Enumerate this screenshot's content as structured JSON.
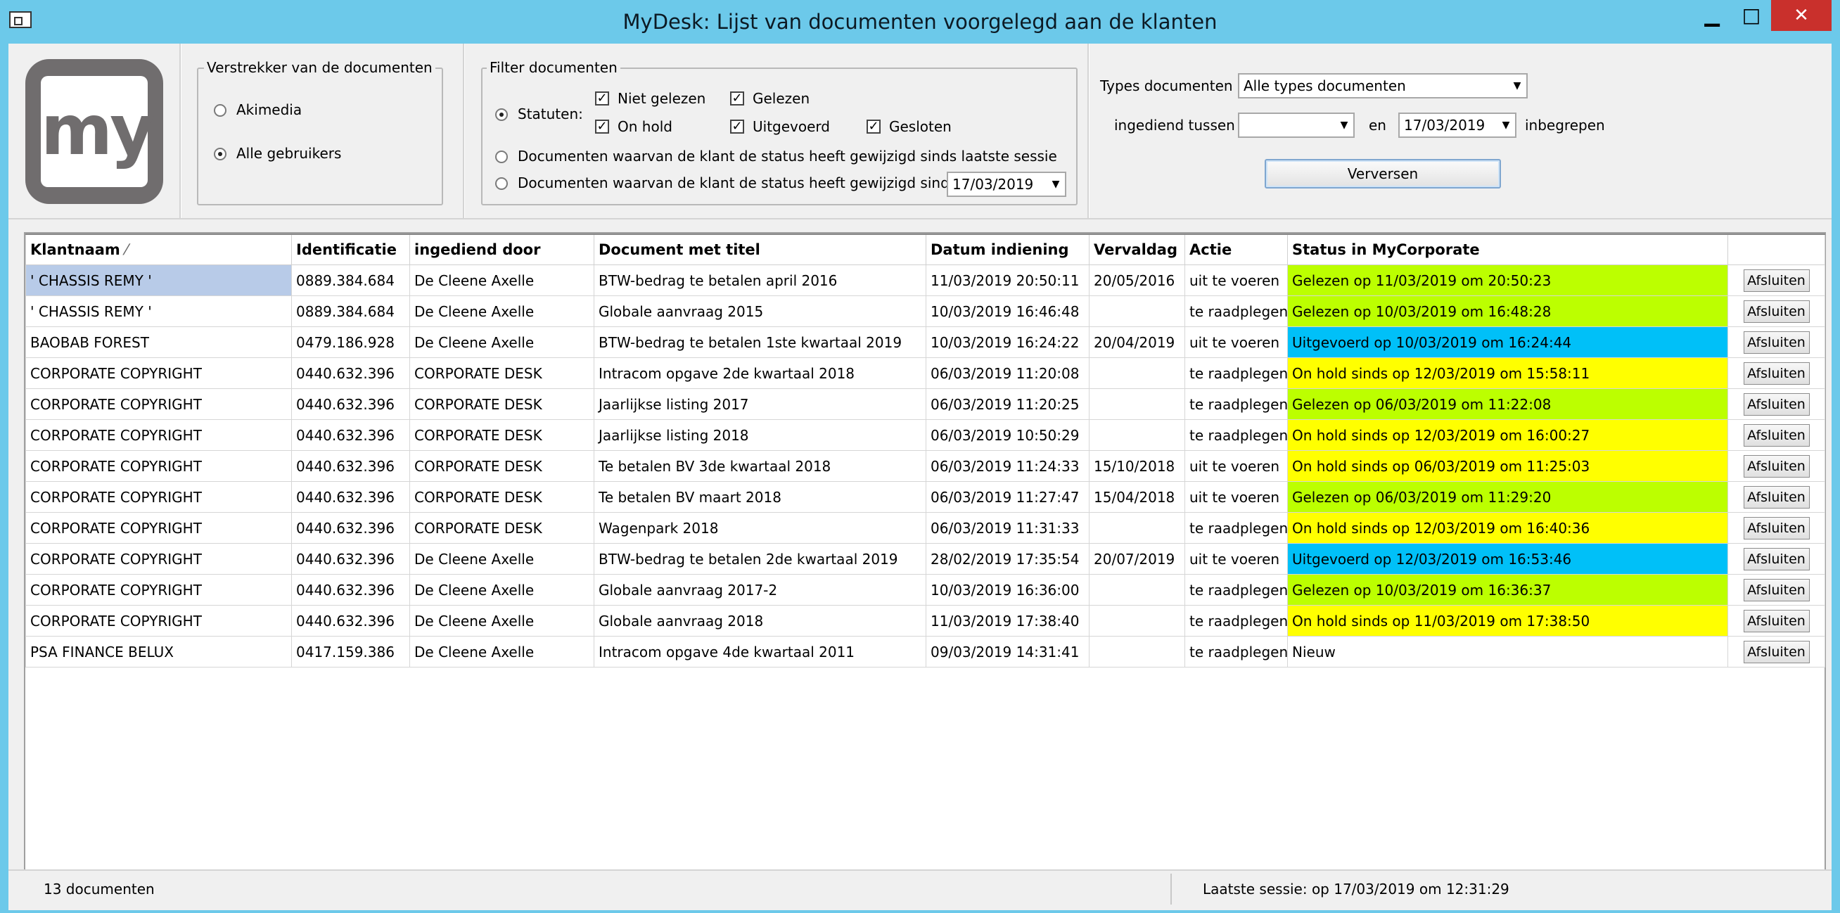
{
  "window": {
    "title": "MyDesk: Lijst van documenten voorgelegd aan de klanten",
    "minimize": "▁",
    "maximize": "□",
    "close": "✕"
  },
  "logo": {
    "text": "my"
  },
  "issuer": {
    "legend": "Verstrekker van de documenten",
    "options": [
      "Akimedia",
      "Alle gebruikers"
    ],
    "selected": 1
  },
  "filter": {
    "legend": "Filter documenten",
    "statuses_label": "Statuten:",
    "checkboxes": [
      {
        "label": "Niet gelezen",
        "checked": true
      },
      {
        "label": "Gelezen",
        "checked": true
      },
      {
        "label": "On hold",
        "checked": true
      },
      {
        "label": "Uitgevoerd",
        "checked": true
      },
      {
        "label": "Gesloten",
        "checked": true
      }
    ],
    "option_since_session": "Documenten waarvan de klant de status heeft gewijzigd sinds laatste sessie",
    "option_since_date": "Documenten waarvan de klant de status heeft gewijzigd sinds",
    "since_date": "17/03/2019"
  },
  "types": {
    "label": "Types documenten",
    "value": "Alle types documenten",
    "between_label": "ingediend tussen",
    "from_value": "",
    "and_label": "en",
    "to_value": "17/03/2019",
    "inclusive_label": "inbegrepen",
    "refresh_button": "Verversen"
  },
  "grid": {
    "columns": [
      "Klantnaam",
      "Identificatie",
      "ingediend door",
      "Document met titel",
      "Datum indiening",
      "Vervaldag",
      "Actie",
      "Status in MyCorporate",
      ""
    ],
    "sort_indicator": "⁄",
    "rows": [
      {
        "client": "' CHASSIS REMY '",
        "id": "0889.384.684",
        "by": "De Cleene Axelle",
        "doc": "BTW-bedrag te betalen april 2016",
        "date": "11/03/2019 20:50:11",
        "due": "20/05/2016",
        "action": "uit te voeren",
        "status": "Gelezen op 11/03/2019 om 20:50:23",
        "status_color": "#bcff00",
        "button": "Afsluiten"
      },
      {
        "client": "' CHASSIS REMY '",
        "id": "0889.384.684",
        "by": "De Cleene Axelle",
        "doc": "Globale aanvraag 2015",
        "date": "10/03/2019 16:46:48",
        "due": "",
        "action": "te raadplegen",
        "status": "Gelezen op 10/03/2019 om 16:48:28",
        "status_color": "#bcff00",
        "button": "Afsluiten"
      },
      {
        "client": "BAOBAB FOREST",
        "id": "0479.186.928",
        "by": "De Cleene Axelle",
        "doc": "BTW-bedrag te betalen 1ste kwartaal 2019",
        "date": "10/03/2019 16:24:22",
        "due": "20/04/2019",
        "action": "uit te voeren",
        "status": "Uitgevoerd op 10/03/2019 om 16:24:44",
        "status_color": "#00c0f8",
        "button": "Afsluiten"
      },
      {
        "client": "CORPORATE COPYRIGHT",
        "id": "0440.632.396",
        "by": "CORPORATE DESK",
        "doc": "Intracom opgave 2de kwartaal 2018",
        "date": "06/03/2019 11:20:08",
        "due": "",
        "action": "te raadplegen",
        "status": "On hold sinds op 12/03/2019 om 15:58:11",
        "status_color": "#ffff00",
        "button": "Afsluiten"
      },
      {
        "client": "CORPORATE COPYRIGHT",
        "id": "0440.632.396",
        "by": "CORPORATE DESK",
        "doc": "Jaarlijkse listing 2017",
        "date": "06/03/2019 11:20:25",
        "due": "",
        "action": "te raadplegen",
        "status": "Gelezen op 06/03/2019 om 11:22:08",
        "status_color": "#bcff00",
        "button": "Afsluiten"
      },
      {
        "client": "CORPORATE COPYRIGHT",
        "id": "0440.632.396",
        "by": "CORPORATE DESK",
        "doc": "Jaarlijkse listing 2018",
        "date": "06/03/2019 10:50:29",
        "due": "",
        "action": "te raadplegen",
        "status": "On hold sinds op 12/03/2019 om 16:00:27",
        "status_color": "#ffff00",
        "button": "Afsluiten"
      },
      {
        "client": "CORPORATE COPYRIGHT",
        "id": "0440.632.396",
        "by": "CORPORATE DESK",
        "doc": "Te betalen BV 3de kwartaal 2018",
        "date": "06/03/2019 11:24:33",
        "due": "15/10/2018",
        "action": "uit te voeren",
        "status": "On hold sinds op 06/03/2019 om 11:25:03",
        "status_color": "#ffff00",
        "button": "Afsluiten"
      },
      {
        "client": "CORPORATE COPYRIGHT",
        "id": "0440.632.396",
        "by": "CORPORATE DESK",
        "doc": "Te betalen BV maart 2018",
        "date": "06/03/2019 11:27:47",
        "due": "15/04/2018",
        "action": "uit te voeren",
        "status": "Gelezen op 06/03/2019 om 11:29:20",
        "status_color": "#bcff00",
        "button": "Afsluiten"
      },
      {
        "client": "CORPORATE COPYRIGHT",
        "id": "0440.632.396",
        "by": "CORPORATE DESK",
        "doc": "Wagenpark 2018",
        "date": "06/03/2019 11:31:33",
        "due": "",
        "action": "te raadplegen",
        "status": "On hold sinds op 12/03/2019 om 16:40:36",
        "status_color": "#ffff00",
        "button": "Afsluiten"
      },
      {
        "client": "CORPORATE COPYRIGHT",
        "id": "0440.632.396",
        "by": "De Cleene Axelle",
        "doc": "BTW-bedrag te betalen 2de kwartaal 2019",
        "date": "28/02/2019 17:35:54",
        "due": "20/07/2019",
        "action": "uit te voeren",
        "status": "Uitgevoerd op 12/03/2019 om 16:53:46",
        "status_color": "#00c0f8",
        "button": "Afsluiten"
      },
      {
        "client": "CORPORATE COPYRIGHT",
        "id": "0440.632.396",
        "by": "De Cleene Axelle",
        "doc": "Globale aanvraag 2017-2",
        "date": "10/03/2019 16:36:00",
        "due": "",
        "action": "te raadplegen",
        "status": "Gelezen op 10/03/2019 om 16:36:37",
        "status_color": "#bcff00",
        "button": "Afsluiten"
      },
      {
        "client": "CORPORATE COPYRIGHT",
        "id": "0440.632.396",
        "by": "De Cleene Axelle",
        "doc": "Globale aanvraag 2018",
        "date": "11/03/2019 17:38:40",
        "due": "",
        "action": "te raadplegen",
        "status": "On hold sinds op 11/03/2019 om 17:38:50",
        "status_color": "#ffff00",
        "button": "Afsluiten"
      },
      {
        "client": "PSA FINANCE BELUX",
        "id": "0417.159.386",
        "by": "De Cleene Axelle",
        "doc": "Intracom opgave 4de kwartaal 2011",
        "date": "09/03/2019 14:31:41",
        "due": "",
        "action": "te raadplegen",
        "status": "Nieuw",
        "status_color": "#ffffff",
        "button": "Afsluiten"
      }
    ]
  },
  "statusbar": {
    "count": "13 documenten",
    "last_session": "Laatste sessie:  op 17/03/2019 om 12:31:29"
  }
}
